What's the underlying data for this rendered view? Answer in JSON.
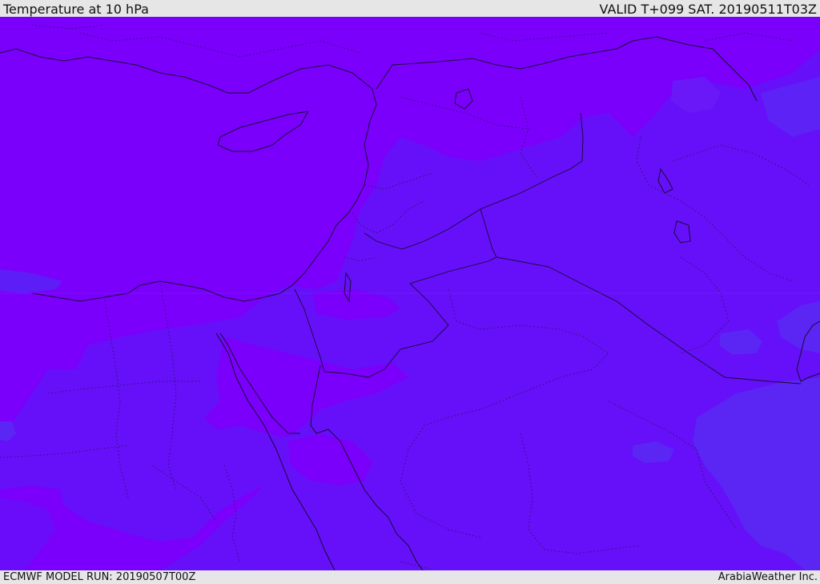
{
  "header": {
    "title": "Temperature at 10 hPa",
    "valid": "VALID T+099 SAT. 20190511T03Z"
  },
  "footer": {
    "model_run": "ECMWF MODEL RUN: 20190507T00Z",
    "credit": "ArabiaWeather Inc."
  },
  "map": {
    "colors": {
      "band_warm": "#7a00fb",
      "band_mid": "#6510f8",
      "band_cool": "#5b25f4",
      "lines": "#1a0a33"
    }
  }
}
